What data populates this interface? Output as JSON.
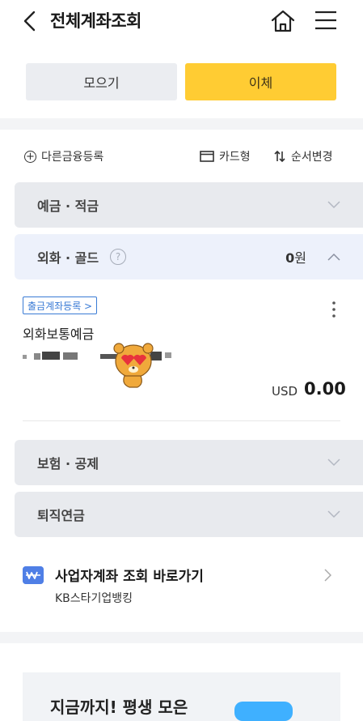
{
  "header": {
    "title": "전체계좌조회"
  },
  "tabs": {
    "collect": "모으기",
    "transfer": "이체"
  },
  "tools": {
    "add_other": "다른금융등록",
    "card_view": "카드형",
    "reorder": "순서변경"
  },
  "sections": {
    "deposit": "예금 · 적금",
    "fx_gold": "외화 · 골드",
    "fx_amount_value": "0",
    "fx_amount_unit": "원",
    "insurance": "보험 · 공제",
    "pension": "퇴직연금"
  },
  "account": {
    "register_tag": "출금계좌등록 >",
    "name": "외화보통예금",
    "currency": "USD",
    "balance": "0.00"
  },
  "shortcut": {
    "title": "사업자계좌 조회 바로가기",
    "subtitle": "KB스타기업뱅킹"
  },
  "promo": {
    "title": "지금까지! 평생 모은"
  },
  "colors": {
    "accent_yellow": "#ffcc33",
    "link_blue": "#3a7bd5",
    "section_gray": "#e8eaee",
    "section_blue": "#edf1fb"
  }
}
